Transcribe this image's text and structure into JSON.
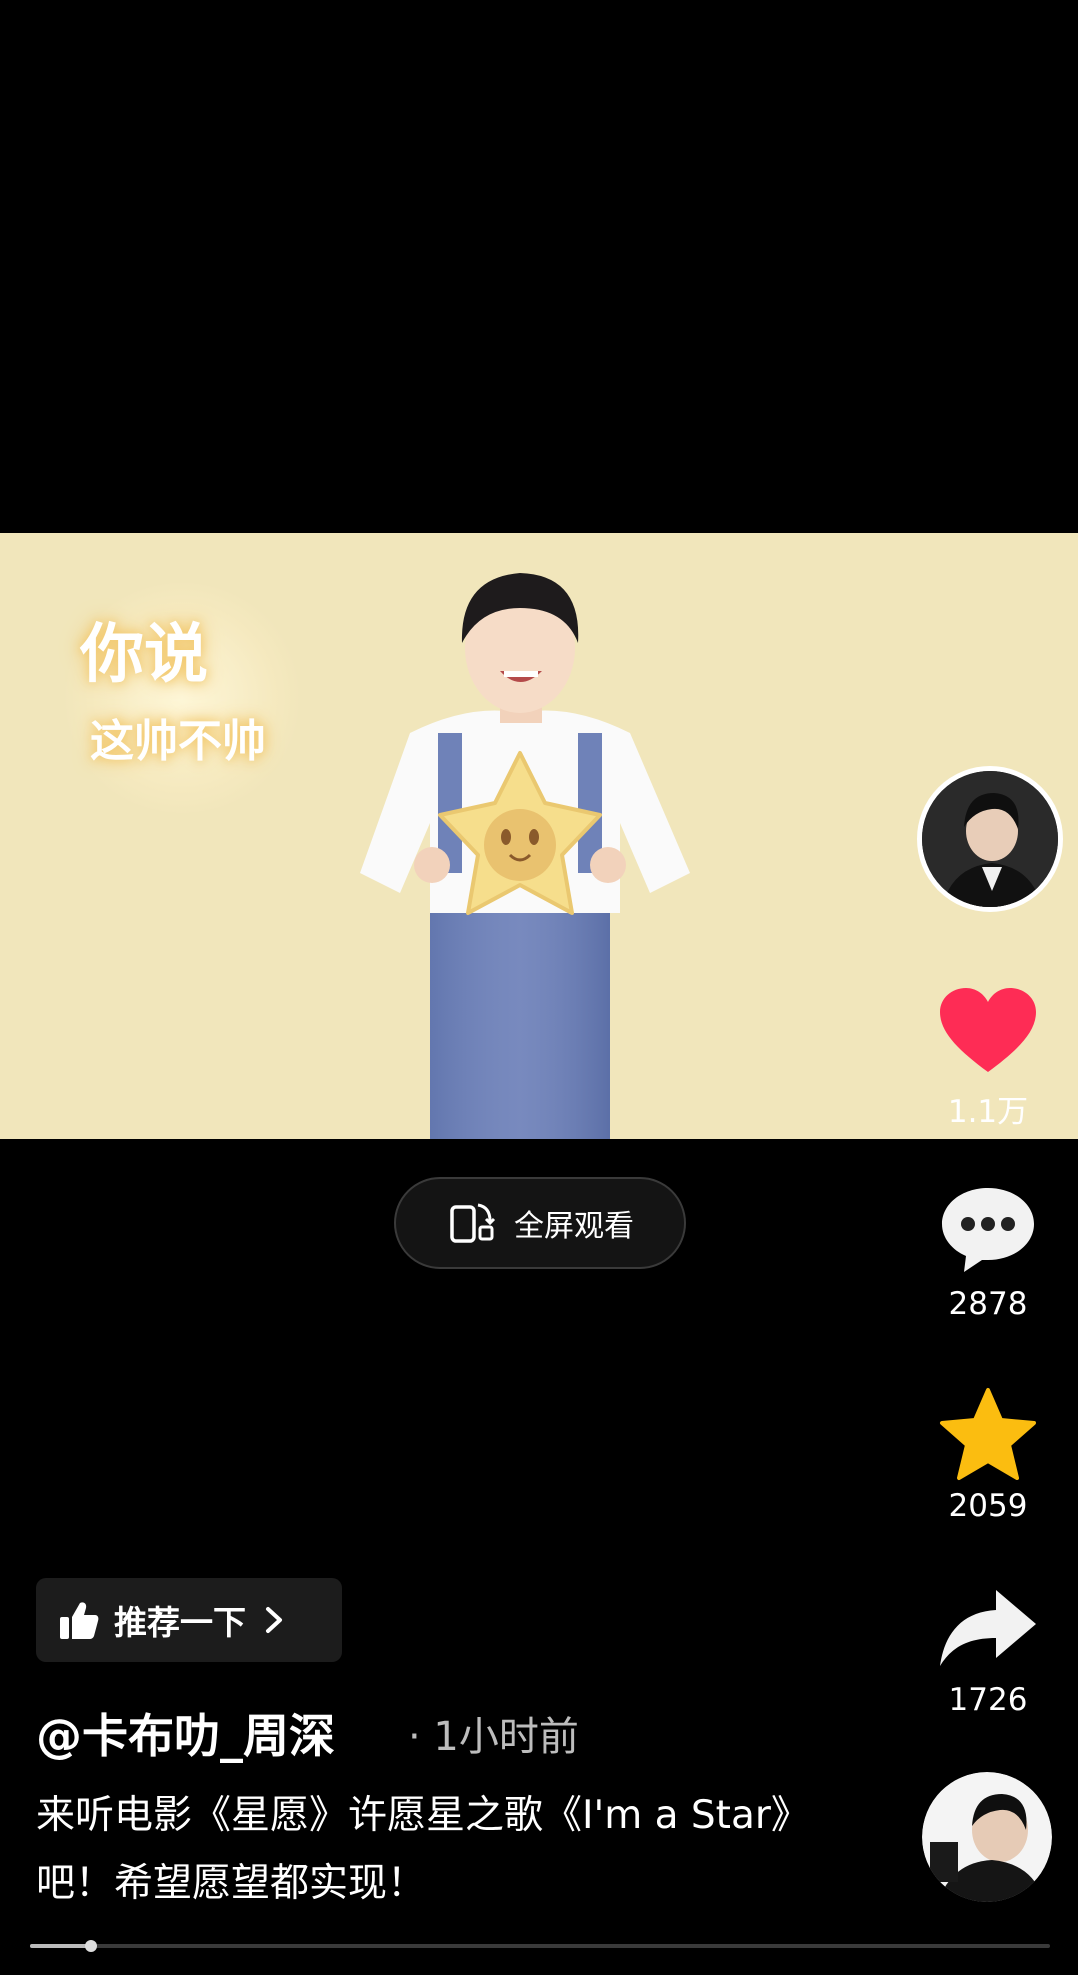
{
  "video": {
    "caption_line1": "你说",
    "caption_line2": "这帅不帅"
  },
  "fullscreen_button": {
    "label": "全屏观看",
    "icon": "rotate-phone-icon"
  },
  "actions": {
    "likes": "1.1万",
    "comments": "2878",
    "favorites": "2059",
    "shares": "1726"
  },
  "recommend": {
    "label": "推荐一下",
    "icon": "thumbs-up-icon"
  },
  "post": {
    "author": "@卡布叻_周深",
    "time": "· 1小时前",
    "description": "来听电影《星愿》许愿星之歌《I'm a Star》吧！希望愿望都实现！"
  },
  "playback": {
    "progress": 0.06
  },
  "colors": {
    "like": "#fe2c55",
    "favorite": "#fbbd10",
    "video_bg": "#f1e6bb"
  }
}
